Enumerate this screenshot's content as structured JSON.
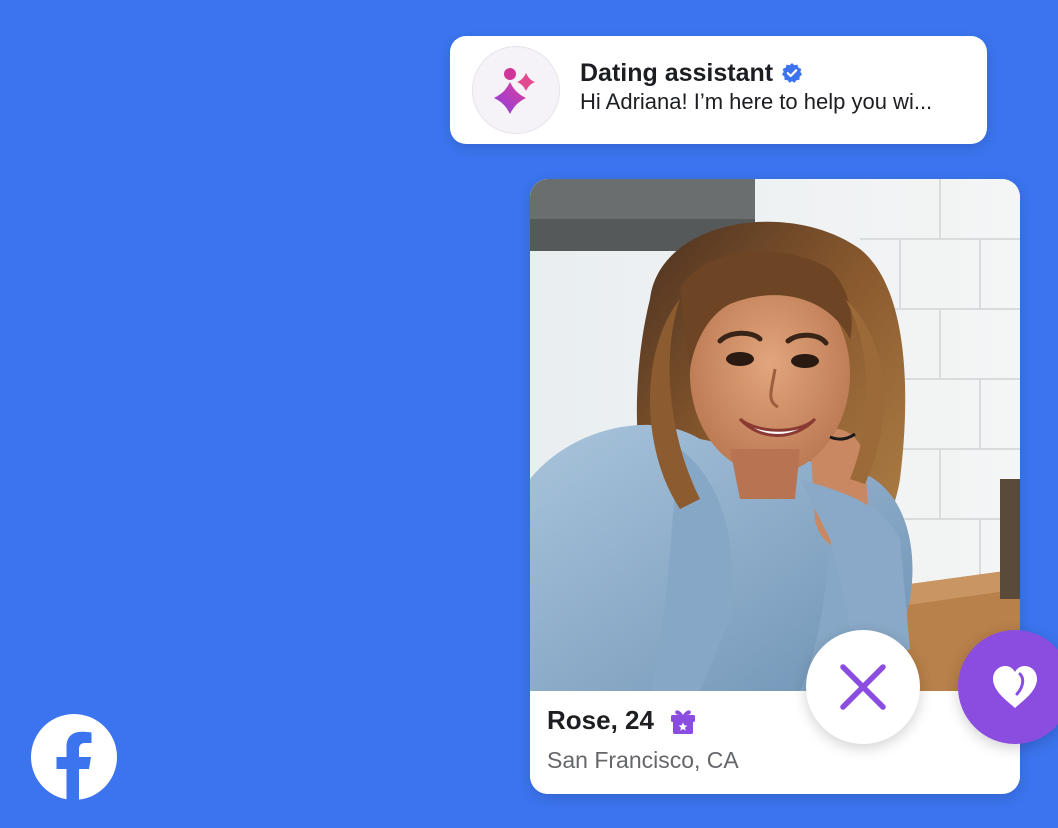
{
  "notification": {
    "title": "Dating assistant",
    "message": "Hi Adriana! I’m here to help you wi...",
    "avatar_icon": "sparkle-icon",
    "verified_icon": "verified-badge-icon"
  },
  "profile": {
    "name_age": "Rose, 24",
    "location": "San Francisco, CA",
    "badge_icon": "gift-icon"
  },
  "actions": {
    "pass_icon": "close-icon",
    "like_icon": "heart-icon"
  },
  "brand": {
    "logo_icon": "facebook-logo-icon"
  },
  "colors": {
    "background": "#3b74ee",
    "accent_purple": "#8b4de0",
    "verified_blue": "#3b74ee",
    "secondary_text": "#65676b"
  }
}
